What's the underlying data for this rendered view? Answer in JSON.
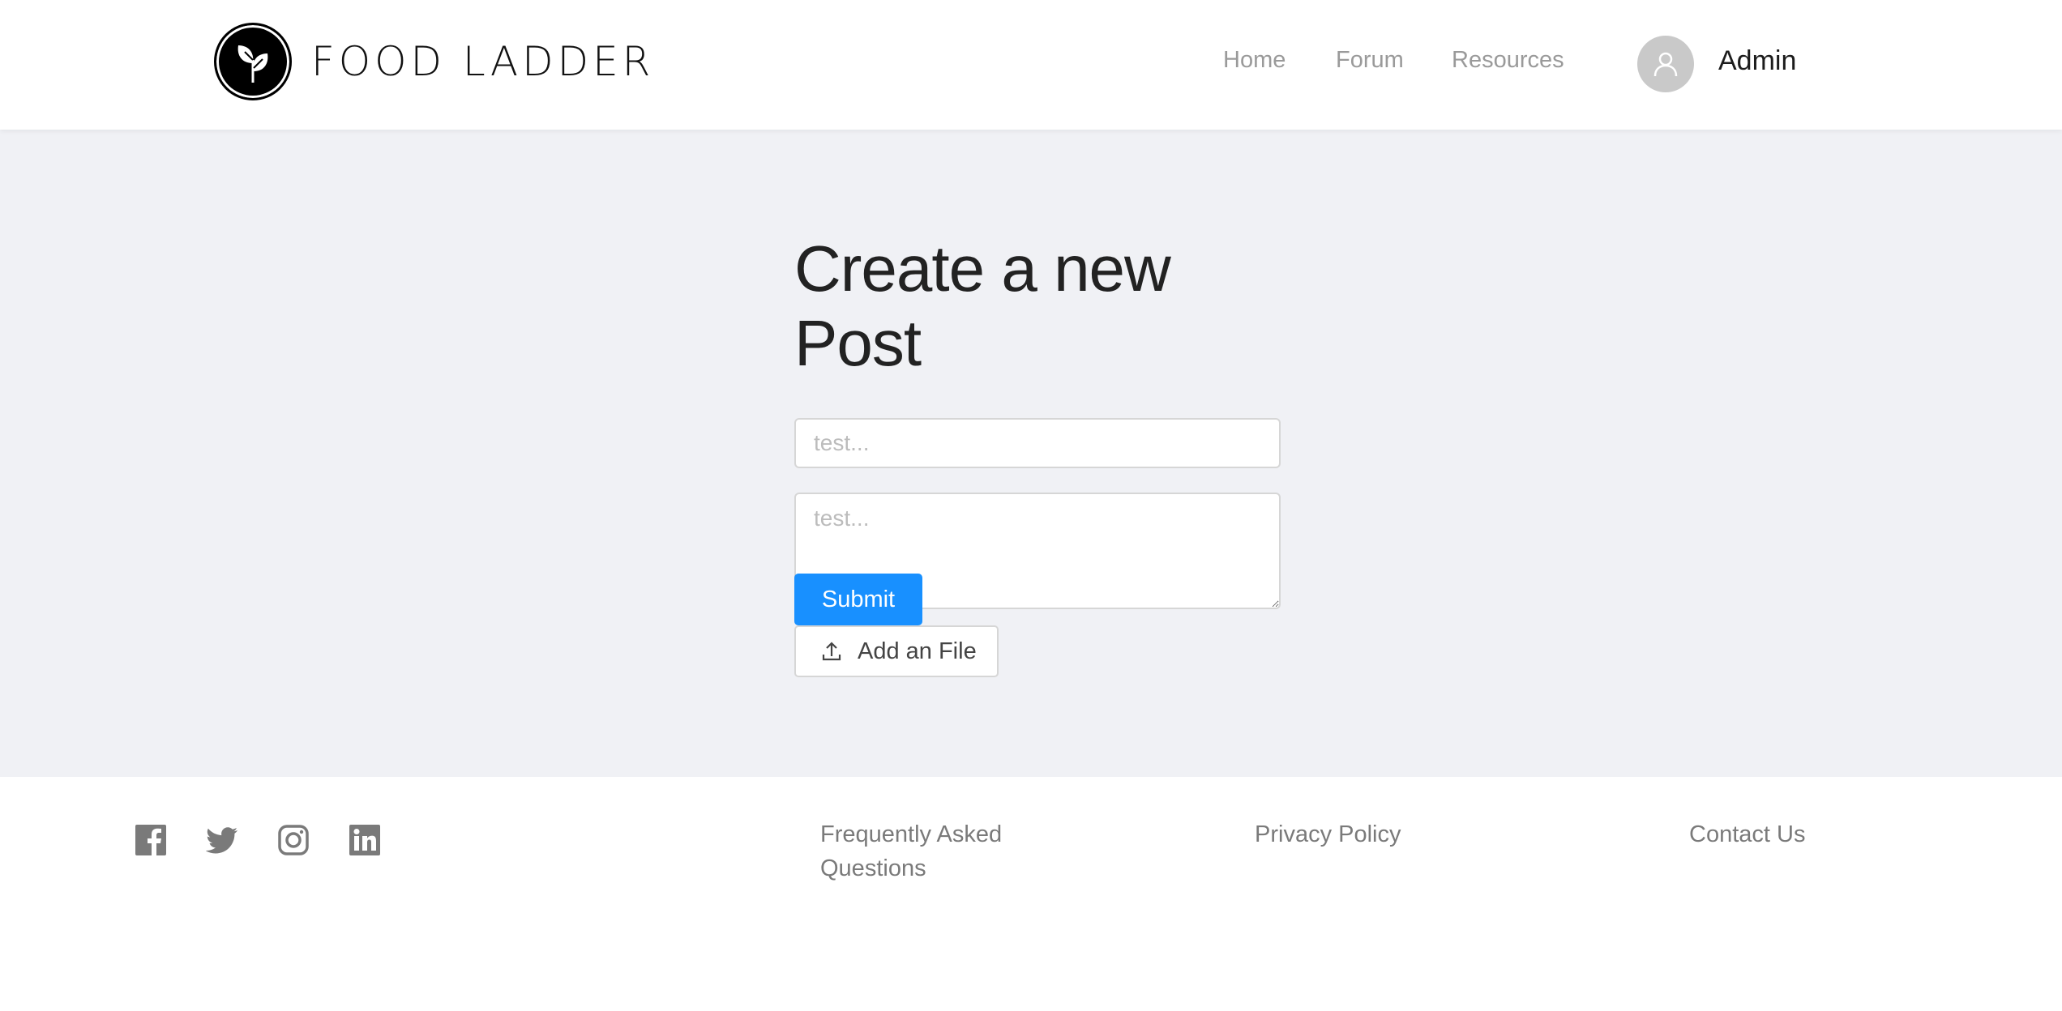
{
  "header": {
    "brand": "FOOD LADDER",
    "logo_icon": "leaf-icon",
    "nav": [
      {
        "label": "Home"
      },
      {
        "label": "Forum"
      },
      {
        "label": "Resources"
      }
    ],
    "user": {
      "name": "Admin",
      "avatar_icon": "user-icon"
    }
  },
  "main": {
    "title": "Create a new Post",
    "title_input": {
      "value": "",
      "placeholder": "test..."
    },
    "body_input": {
      "value": "",
      "placeholder": "test..."
    },
    "submit_label": "Submit",
    "upload_label": "Add an File",
    "upload_icon": "upload-icon"
  },
  "footer": {
    "social": [
      {
        "name": "facebook-icon"
      },
      {
        "name": "twitter-icon"
      },
      {
        "name": "instagram-icon"
      },
      {
        "name": "linkedin-icon"
      }
    ],
    "links": [
      {
        "label": "Frequently Asked Questions"
      },
      {
        "label": "Privacy Policy"
      },
      {
        "label": "Contact Us"
      }
    ]
  },
  "colors": {
    "primary": "#1890ff",
    "background": "#f0f1f5",
    "nav_text": "#9a9a9a",
    "footer_text": "#7a7a7a"
  }
}
